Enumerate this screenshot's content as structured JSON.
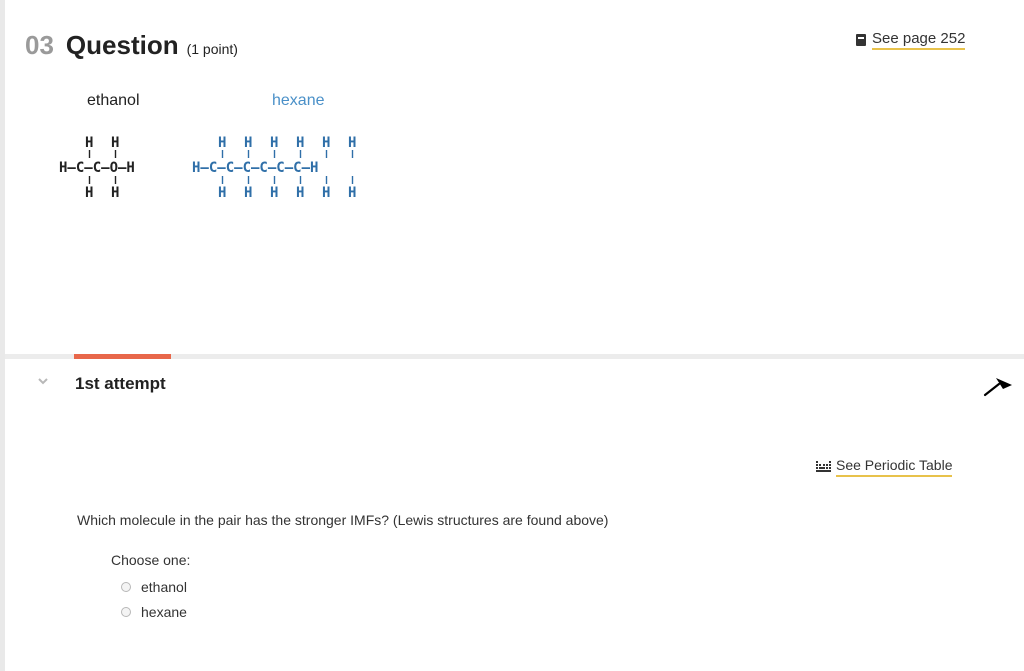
{
  "question": {
    "number": "03",
    "title": "Question",
    "points": "(1 point)"
  },
  "see_page": {
    "label": "See page 252",
    "icon": "book-icon"
  },
  "molecules": {
    "ethanol": {
      "name": "ethanol",
      "color": "#222222",
      "top_row": [
        "H",
        "H"
      ],
      "middle_row": "H–C–C–O–H",
      "bottom_row": [
        "H",
        "H"
      ]
    },
    "hexane": {
      "name": "hexane",
      "color": "#2f6fa8",
      "top_row": [
        "H",
        "H",
        "H",
        "H",
        "H",
        "H"
      ],
      "middle_row": "H–C–C–C–C–C–C–H",
      "bottom_row": [
        "H",
        "H",
        "H",
        "H",
        "H",
        "H"
      ]
    }
  },
  "attempt": {
    "title": "1st attempt",
    "accent_color": "#e8674a"
  },
  "periodic_table": {
    "label": "See Periodic Table",
    "icon": "periodic-table-icon"
  },
  "prompt": "Which molecule in the pair has the stronger IMFs? (Lewis structures are found above)",
  "choose_label": "Choose one:",
  "options": [
    "ethanol",
    "hexane"
  ]
}
